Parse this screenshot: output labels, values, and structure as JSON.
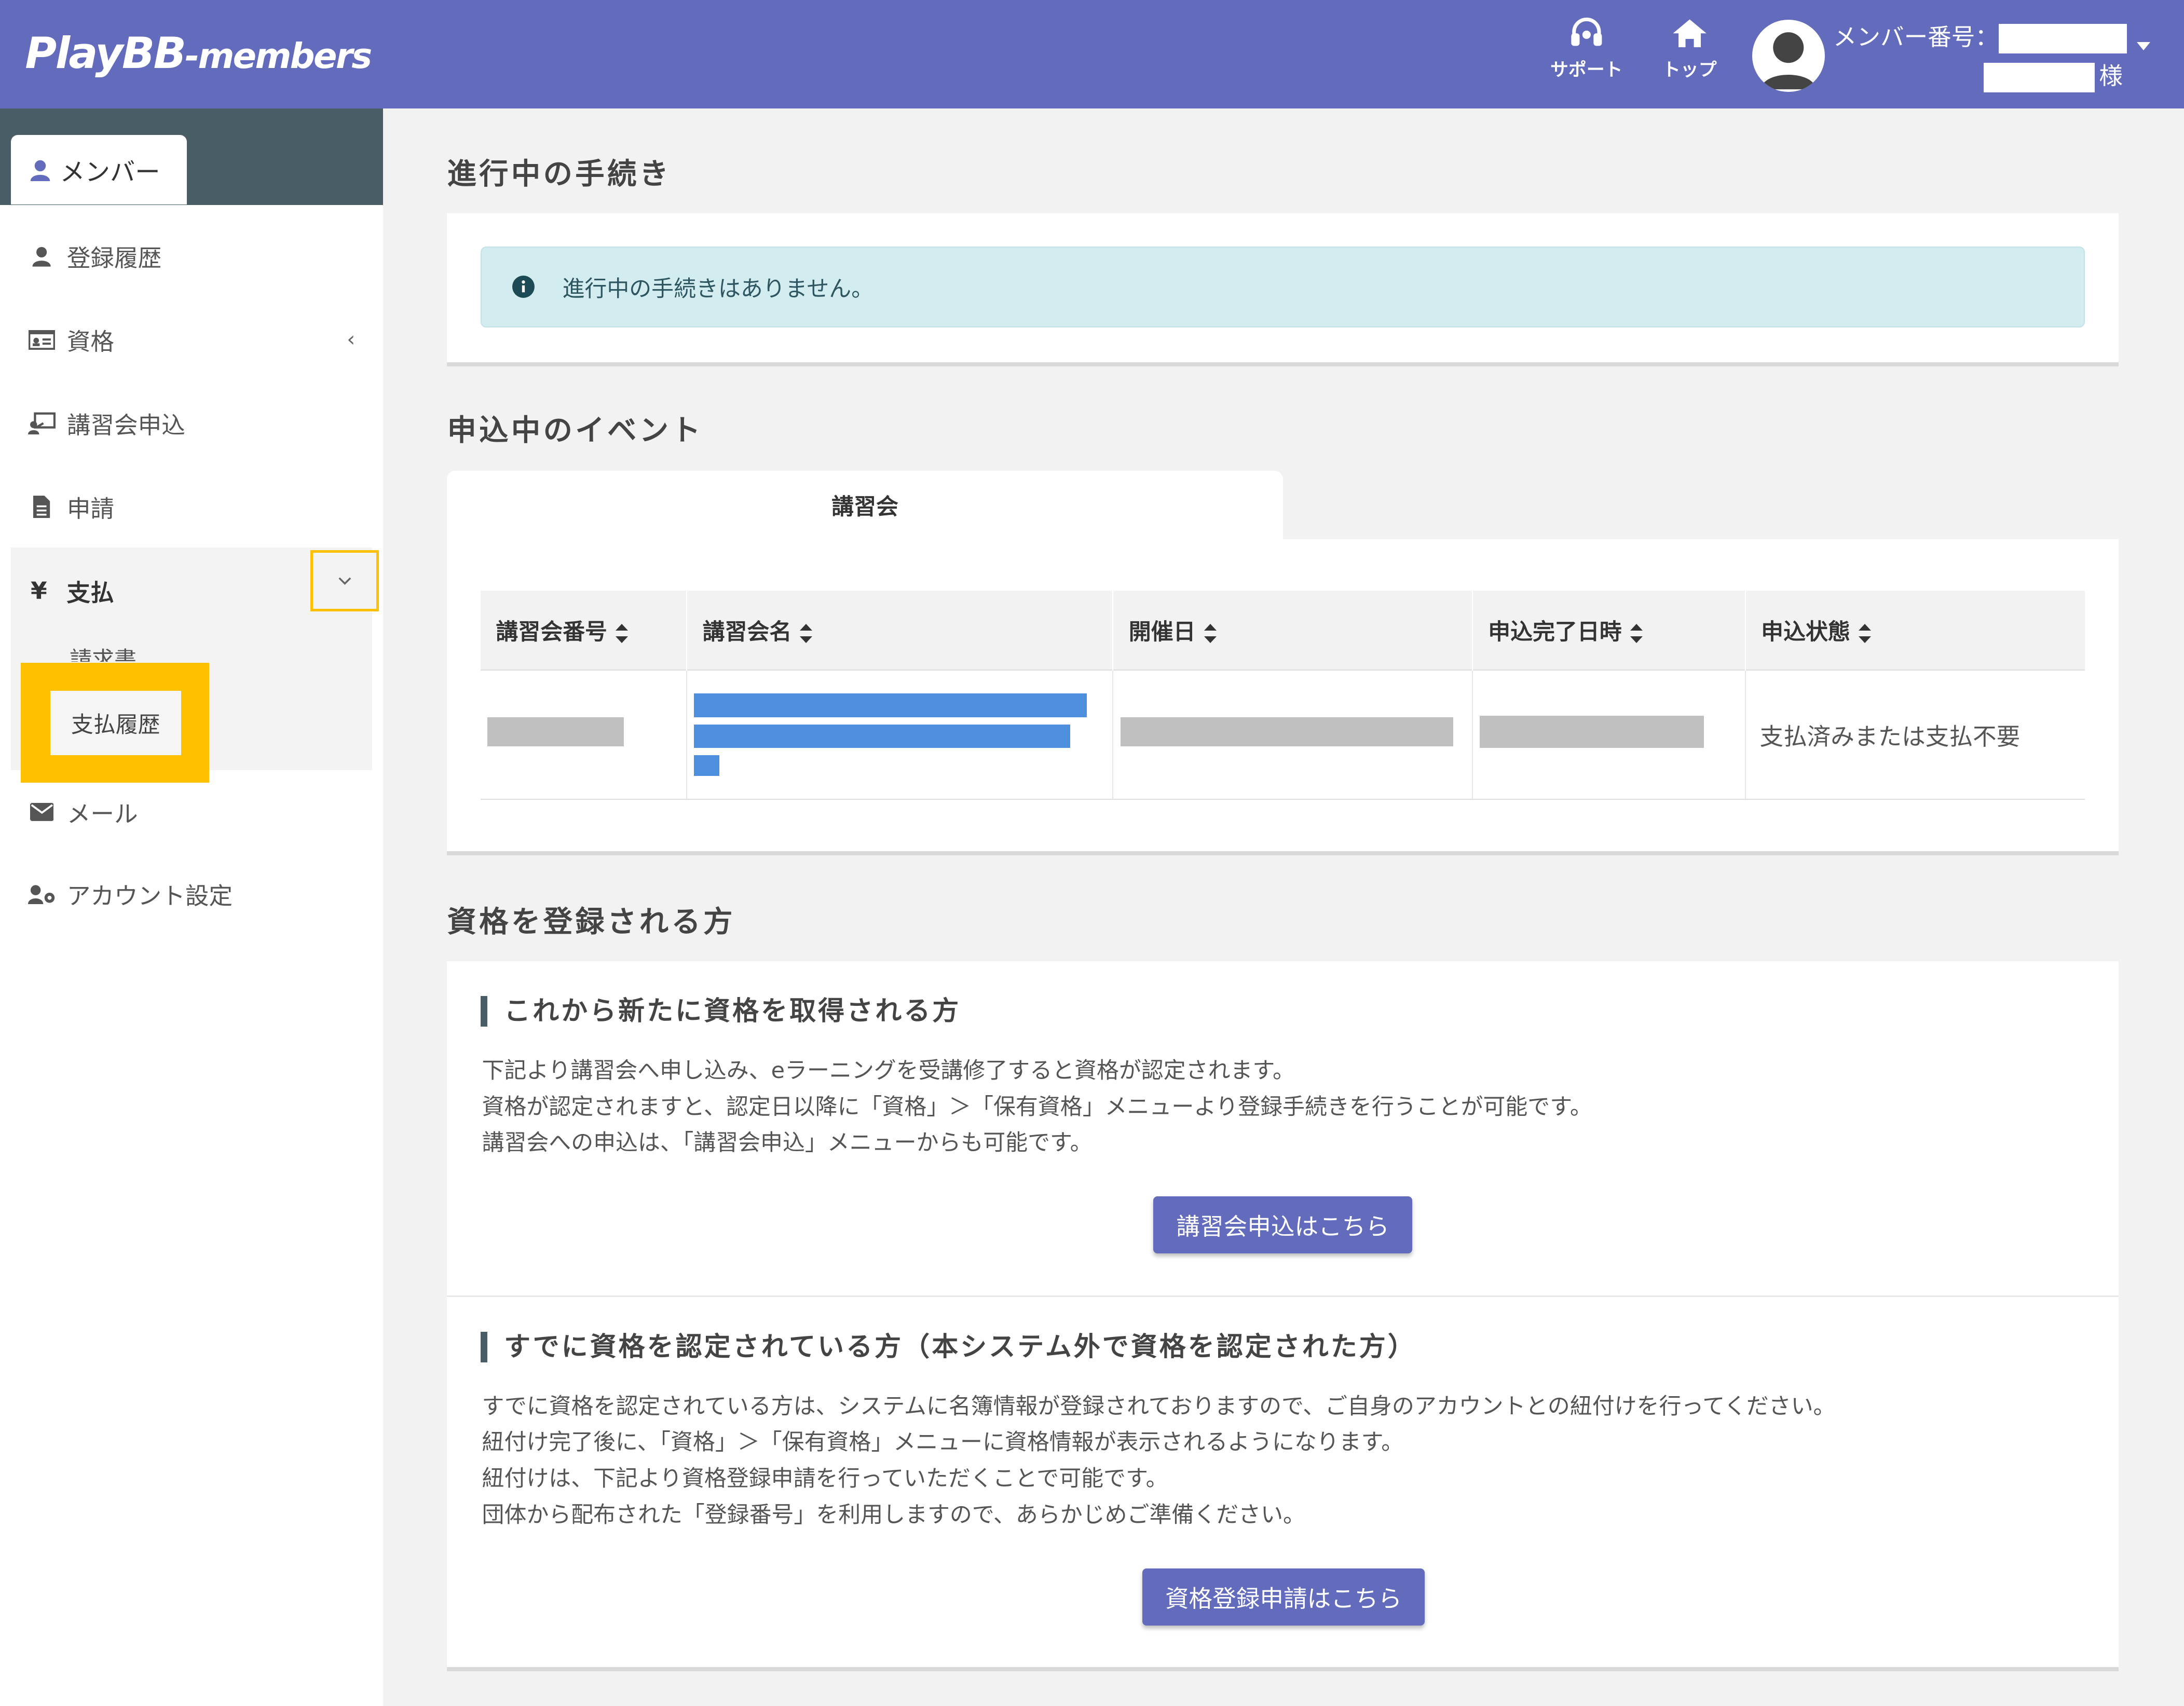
{
  "header": {
    "logo_main": "PlayBB",
    "logo_suffix": "-members",
    "support_label": "サポート",
    "top_label": "トップ",
    "member_no_label": "メンバー番号：",
    "honorific": "様"
  },
  "sidebar": {
    "tab_label": "メンバー",
    "items": [
      {
        "label": "登録履歴",
        "icon": "user-icon"
      },
      {
        "label": "資格",
        "icon": "id-card-icon"
      },
      {
        "label": "講習会申込",
        "icon": "chalkboard-icon"
      },
      {
        "label": "申請",
        "icon": "file-icon"
      },
      {
        "label": "支払",
        "icon": "yen-icon"
      },
      {
        "label": "メール",
        "icon": "envelope-icon"
      },
      {
        "label": "アカウント設定",
        "icon": "user-gear-icon"
      }
    ],
    "payment_sub": {
      "invoice": "請求書",
      "history": "支払履歴"
    },
    "highlight_color": "#ffc000"
  },
  "sections": {
    "in_progress": {
      "title": "進行中の手続き",
      "alert": "進行中の手続きはありません。"
    },
    "events": {
      "title": "申込中のイベント",
      "tab": "講習会",
      "columns": [
        "講習会番号",
        "講習会名",
        "開催日",
        "申込完了日時",
        "申込状態"
      ],
      "row": {
        "status": "支払済みまたは支払不要"
      }
    },
    "register": {
      "title": "資格を登録される方",
      "new": {
        "heading": "これから新たに資格を取得される方",
        "lines": [
          "下記より講習会へ申し込み、eラーニングを受講修了すると資格が認定されます。",
          "資格が認定されますと、認定日以降に「資格」＞「保有資格」メニューより登録手続きを行うことが可能です。",
          "講習会への申込は、「講習会申込」メニューからも可能です。"
        ],
        "button": "講習会申込はこちら"
      },
      "existing": {
        "heading": "すでに資格を認定されている方（本システム外で資格を認定された方）",
        "lines": [
          "すでに資格を認定されている方は、システムに名簿情報が登録されておりますので、ご自身のアカウントとの紐付けを行ってください。",
          "紐付け完了後に、「資格」＞「保有資格」メニューに資格情報が表示されるようになります。",
          "紐付けは、下記より資格登録申請を行っていただくことで可能です。",
          "団体から配布された「登録番号」を利用しますので、あらかじめご準備ください。"
        ],
        "button": "資格登録申請はこちら"
      }
    }
  },
  "colors": {
    "header_bg": "#636bbd",
    "sidebar_head_bg": "#485d66",
    "button_bg": "#636bbd",
    "alert_bg": "#d3ecf0"
  }
}
